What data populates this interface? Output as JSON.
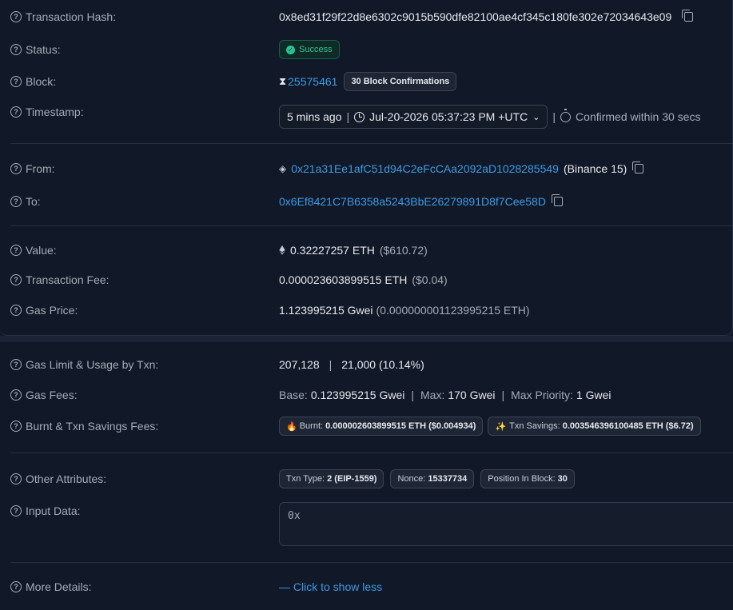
{
  "overview": {
    "tx_hash_label": "Transaction Hash:",
    "tx_hash": "0x8ed31f29f22d8e6302c9015b590dfe82100ae4cf345c180fe302e72034643e09",
    "status_label": "Status:",
    "status": "Success",
    "block_label": "Block:",
    "block_number": "25575461",
    "block_confirmations": "30 Block Confirmations",
    "timestamp_label": "Timestamp:",
    "timestamp_relative": "5 mins ago",
    "timestamp_absolute": "Jul-20-2026 05:37:23 PM +UTC",
    "confirmed_within": "Confirmed within 30 secs",
    "from_label": "From:",
    "from_address": "0x21a31Ee1afC51d94C2eFcCAa2092aD1028285549",
    "from_name": "(Binance 15)",
    "to_label": "To:",
    "to_address": "0x6Ef8421C7B6358a5243BbE26279891D8f7Cee58D",
    "value_label": "Value:",
    "value_eth": "0.32227257 ETH",
    "value_usd": "($610.72)",
    "fee_label": "Transaction Fee:",
    "fee_eth": "0.000023603899515 ETH",
    "fee_usd": "($0.04)",
    "gas_price_label": "Gas Price:",
    "gas_price_gwei": "1.123995215 Gwei",
    "gas_price_eth": "(0.000000001123995215 ETH)"
  },
  "more": {
    "gas_limit_label": "Gas Limit & Usage by Txn:",
    "gas_limit": "207,128",
    "gas_used": "21,000 (10.14%)",
    "gas_fees_label": "Gas Fees:",
    "base_label": "Base:",
    "base_value": "0.123995215 Gwei",
    "max_label": "Max:",
    "max_value": "170 Gwei",
    "max_priority_label": "Max Priority:",
    "max_priority_value": "1 Gwei",
    "burnt_label": "Burnt & Txn Savings Fees:",
    "burnt_key": "Burnt:",
    "burnt_value": "0.000002603899515 ETH ($0.004934)",
    "savings_key": "Txn Savings:",
    "savings_value": "0.003546396100485 ETH ($6.72)",
    "other_label": "Other Attributes:",
    "txn_type_key": "Txn Type:",
    "txn_type_value": "2 (EIP-1559)",
    "nonce_key": "Nonce:",
    "nonce_value": "15337734",
    "position_key": "Position In Block:",
    "position_value": "30",
    "input_label": "Input Data:",
    "input_value": "0x",
    "more_label": "More Details:",
    "more_link": "— Click to show less"
  },
  "colors": {
    "accent_link": "#3b9ce6",
    "success": "#27c497",
    "background": "#111827"
  }
}
